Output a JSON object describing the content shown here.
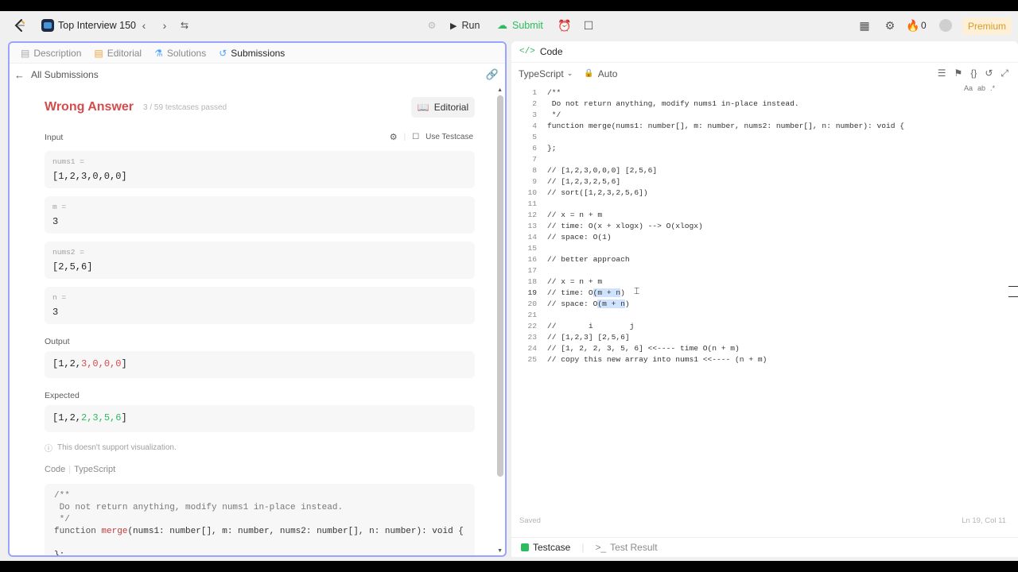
{
  "topbar": {
    "list_title": "Top Interview 150",
    "run_label": "Run",
    "submit_label": "Submit",
    "counter": "0",
    "premium_label": "Premium"
  },
  "left_tabs": [
    {
      "label": "Description"
    },
    {
      "label": "Editorial"
    },
    {
      "label": "Solutions"
    },
    {
      "label": "Submissions"
    }
  ],
  "back_label": "All Submissions",
  "result": {
    "status": "Wrong Answer",
    "passed": "3 / 59 testcases passed",
    "editorial_button": "Editorial"
  },
  "input": {
    "section_label": "Input",
    "use_testcase": "Use Testcase",
    "params": [
      {
        "name": "nums1 =",
        "value": "[1,2,3,0,0,0]"
      },
      {
        "name": "m =",
        "value": "3"
      },
      {
        "name": "nums2 =",
        "value": "[2,5,6]"
      },
      {
        "name": "n =",
        "value": "3"
      }
    ]
  },
  "output": {
    "section_label": "Output",
    "value_ok": "[1,2,",
    "value_bad": "3,0,0,0",
    "value_end": "]"
  },
  "expected": {
    "section_label": "Expected",
    "value_ok": "[1,2,",
    "value_good": "2,3,5,6",
    "value_end": "]"
  },
  "note": "This doesn't support visualization.",
  "code_section": {
    "code_label": "Code",
    "lang_label": "TypeScript",
    "comment1": "/**",
    "comment2": " Do not return anything, modify nums1 in-place instead.",
    "comment3": " */",
    "sig_kw": "function",
    "sig_fn": "merge",
    "sig_rest": "(nums1: number[], m: number, nums2: number[], n: number): void {",
    "close": "};"
  },
  "right": {
    "tab_label": "Code",
    "language": "TypeScript",
    "mode": "Auto",
    "find_case": "Aa",
    "find_word": "ab",
    "find_regex": ".*",
    "saved": "Saved",
    "position": "Ln 19, Col 11",
    "lines": [
      {
        "n": "1",
        "t": "/**"
      },
      {
        "n": "2",
        "t": " Do not return anything, modify nums1 in-place instead."
      },
      {
        "n": "3",
        "t": " */"
      },
      {
        "n": "4",
        "t": "function merge(nums1: number[], m: number, nums2: number[], n: number): void {"
      },
      {
        "n": "5",
        "t": ""
      },
      {
        "n": "6",
        "t": "};"
      },
      {
        "n": "7",
        "t": ""
      },
      {
        "n": "8",
        "t": "// [1,2,3,0,0,0] [2,5,6]"
      },
      {
        "n": "9",
        "t": "// [1,2,3,2,5,6]"
      },
      {
        "n": "10",
        "t": "// sort([1,2,3,2,5,6])"
      },
      {
        "n": "11",
        "t": ""
      },
      {
        "n": "12",
        "t": "// x = n + m"
      },
      {
        "n": "13",
        "t": "// time: O(x + xlogx) --> O(xlogx)"
      },
      {
        "n": "14",
        "t": "// space: O(1)"
      },
      {
        "n": "15",
        "t": ""
      },
      {
        "n": "16",
        "t": "// better approach"
      },
      {
        "n": "17",
        "t": ""
      },
      {
        "n": "18",
        "t": "// x = n + m"
      },
      {
        "n": "19",
        "t": "// time: O(m + n)"
      },
      {
        "n": "20",
        "t": "// space: O(m + n)"
      },
      {
        "n": "21",
        "t": ""
      },
      {
        "n": "22",
        "t": "//       i        j"
      },
      {
        "n": "23",
        "t": "// [1,2,3] [2,5,6]"
      },
      {
        "n": "24",
        "t": "// [1, 2, 2, 3, 5, 6] <<---- time O(n + m)"
      },
      {
        "n": "25",
        "t": "// copy this new array into nums1 <<---- (n + m)"
      }
    ]
  },
  "bottom_tabs": {
    "testcase": "Testcase",
    "test_result": "Test Result"
  },
  "colors": {
    "accent_green": "#2cbb5d",
    "wrong_red": "#d44c4c",
    "premium_bg": "#fdf0d7",
    "premium_text": "#d79b2d",
    "focus_border": "#9aa4ff"
  }
}
